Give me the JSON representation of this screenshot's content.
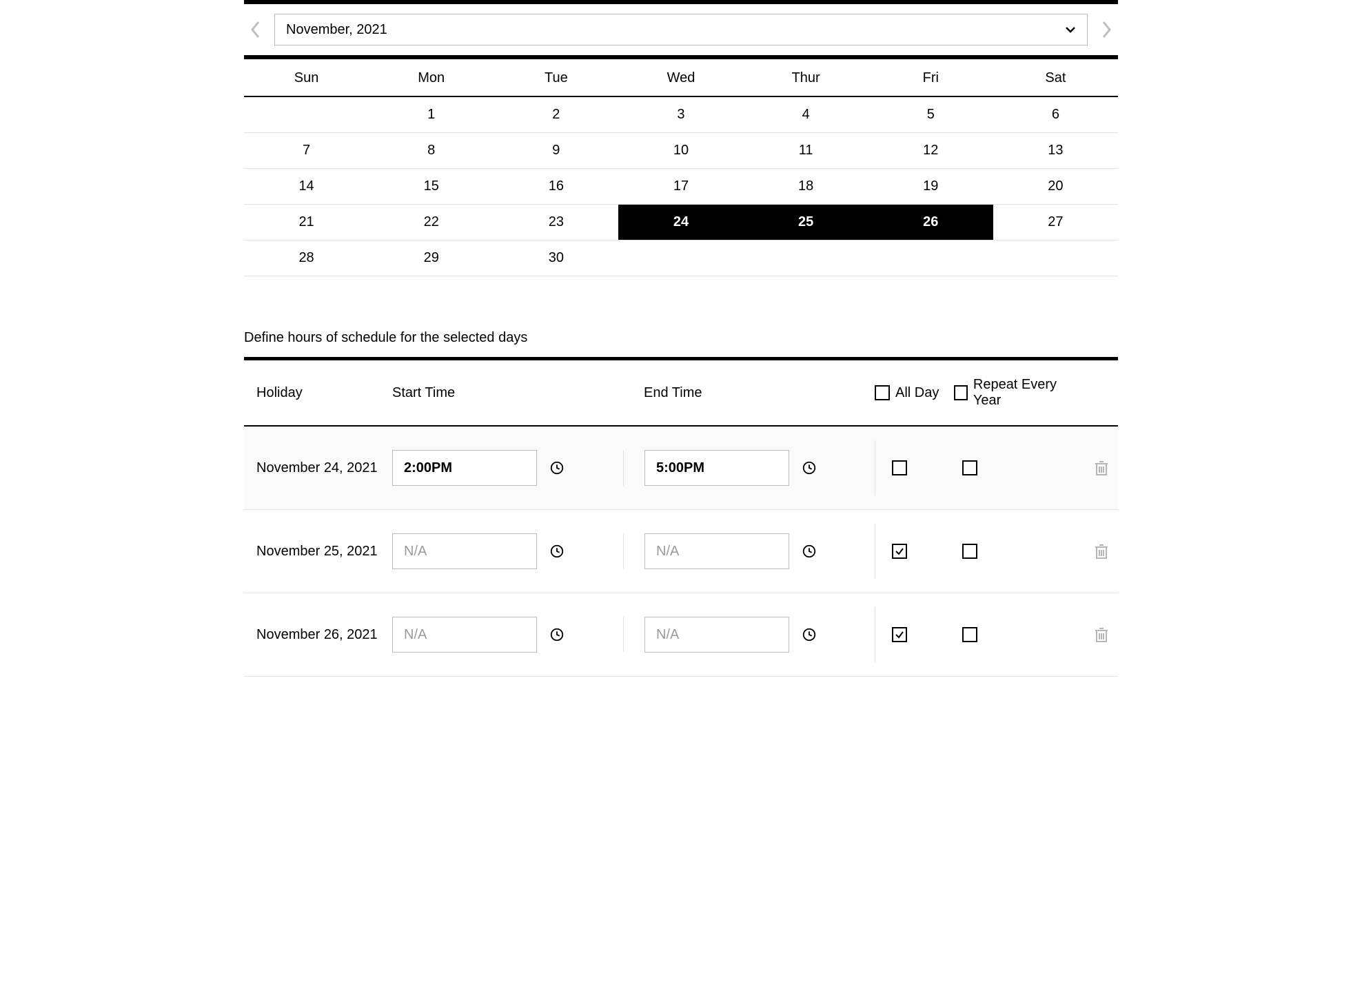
{
  "monthSelector": {
    "label": "November, 2021"
  },
  "calendar": {
    "dows": [
      "Sun",
      "Mon",
      "Tue",
      "Wed",
      "Thur",
      "Fri",
      "Sat"
    ],
    "weeks": [
      [
        {
          "d": ""
        },
        {
          "d": "1"
        },
        {
          "d": "2"
        },
        {
          "d": "3"
        },
        {
          "d": "4"
        },
        {
          "d": "5"
        },
        {
          "d": "6"
        }
      ],
      [
        {
          "d": "7"
        },
        {
          "d": "8"
        },
        {
          "d": "9"
        },
        {
          "d": "10"
        },
        {
          "d": "11"
        },
        {
          "d": "12"
        },
        {
          "d": "13"
        }
      ],
      [
        {
          "d": "14"
        },
        {
          "d": "15"
        },
        {
          "d": "16"
        },
        {
          "d": "17"
        },
        {
          "d": "18"
        },
        {
          "d": "19"
        },
        {
          "d": "20"
        }
      ],
      [
        {
          "d": "21"
        },
        {
          "d": "22"
        },
        {
          "d": "23"
        },
        {
          "d": "24",
          "sel": true
        },
        {
          "d": "25",
          "sel": true
        },
        {
          "d": "26",
          "sel": true
        },
        {
          "d": "27"
        }
      ],
      [
        {
          "d": "28"
        },
        {
          "d": "29"
        },
        {
          "d": "30"
        },
        {
          "d": ""
        },
        {
          "d": ""
        },
        {
          "d": ""
        },
        {
          "d": ""
        }
      ]
    ]
  },
  "schedule": {
    "title": "Define hours of schedule for the selected days",
    "headers": {
      "holiday": "Holiday",
      "start": "Start Time",
      "end": "End Time",
      "allday": "All Day",
      "repeat": "Repeat Every Year"
    },
    "headerAllDayChecked": false,
    "headerRepeatChecked": false,
    "placeholder": "N/A",
    "rows": [
      {
        "holiday": "November 24, 2021",
        "start": "2:00PM",
        "end": "5:00PM",
        "allday": false,
        "repeat": false,
        "alt": true
      },
      {
        "holiday": "November 25, 2021",
        "start": "",
        "end": "",
        "allday": true,
        "repeat": false,
        "alt": false
      },
      {
        "holiday": "November 26, 2021",
        "start": "",
        "end": "",
        "allday": true,
        "repeat": false,
        "alt": false
      }
    ]
  }
}
